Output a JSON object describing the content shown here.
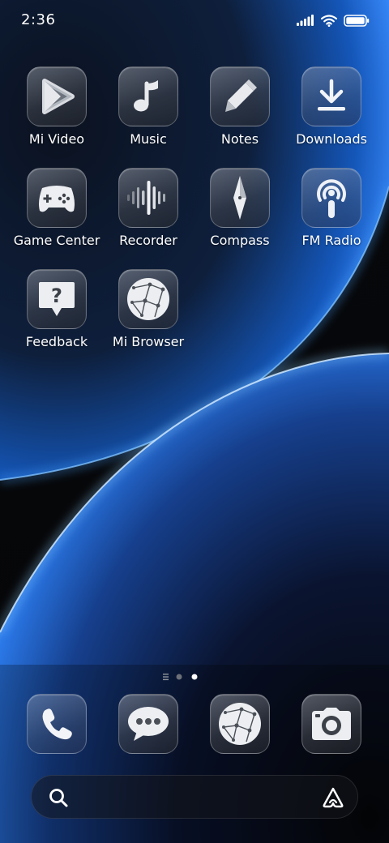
{
  "status_bar": {
    "time": "2:36",
    "icons": [
      "signal-icon",
      "wifi-icon",
      "battery-icon"
    ]
  },
  "apps": [
    {
      "label": "Mi Video",
      "icon": "play-icon"
    },
    {
      "label": "Music",
      "icon": "music-note-icon"
    },
    {
      "label": "Notes",
      "icon": "pencil-icon"
    },
    {
      "label": "Downloads",
      "icon": "download-icon"
    },
    {
      "label": "Game Center",
      "icon": "gamepad-icon"
    },
    {
      "label": "Recorder",
      "icon": "sound-wave-icon"
    },
    {
      "label": "Compass",
      "icon": "compass-needle-icon"
    },
    {
      "label": "FM Radio",
      "icon": "radio-antenna-icon"
    },
    {
      "label": "Feedback",
      "icon": "question-bubble-icon"
    },
    {
      "label": "Mi Browser",
      "icon": "globe-network-icon"
    }
  ],
  "page_indicator": {
    "pages": 3,
    "current": 3
  },
  "dock": [
    {
      "name": "phone",
      "icon": "phone-icon"
    },
    {
      "name": "messages",
      "icon": "message-bubble-icon"
    },
    {
      "name": "browser",
      "icon": "globe-network-icon"
    },
    {
      "name": "camera",
      "icon": "camera-icon"
    }
  ],
  "search_bar": {
    "icon": "search-icon",
    "assistant_icon": "assistant-icon"
  },
  "colors": {
    "background": "#050608",
    "wallpaper_blue": "#1e6fe0",
    "wallpaper_glow": "#6fb4ff",
    "text": "#ffffff"
  }
}
